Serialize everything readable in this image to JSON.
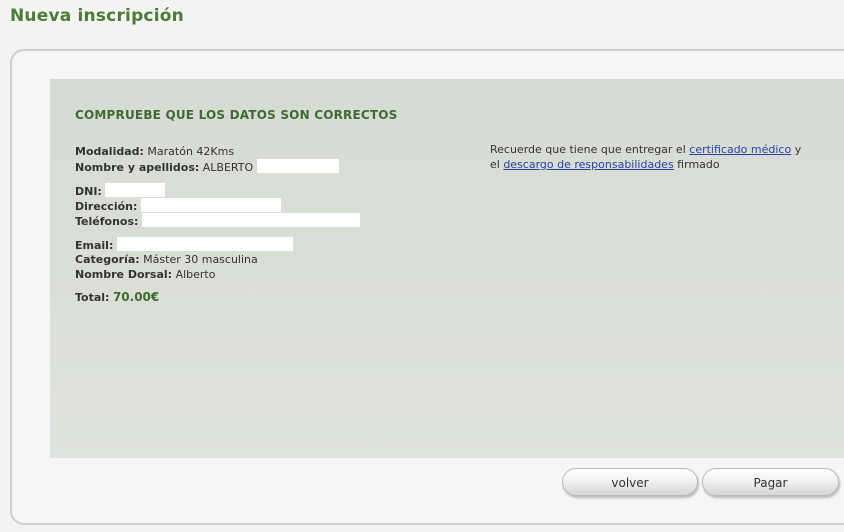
{
  "page": {
    "title": "Nueva inscripción"
  },
  "summary": {
    "heading": "COMPRUEBE QUE LOS DATOS SON CORRECTOS",
    "fields": {
      "modalidad": {
        "label": "Modalidad:",
        "value": "Maratón 42Kms"
      },
      "nombre": {
        "label": "Nombre y apellidos:",
        "value": "ALBERTO"
      },
      "dni": {
        "label": "DNI:"
      },
      "direccion": {
        "label": "Dirección:"
      },
      "telefonos": {
        "label": "Teléfonos:"
      },
      "email": {
        "label": "Email:"
      },
      "categoria": {
        "label": "Categoría:",
        "value": "Máster 30 masculina"
      },
      "dorsal": {
        "label": "Nombre Dorsal:",
        "value": "Alberto"
      }
    },
    "total": {
      "label": "Total:",
      "value": "70.00€"
    }
  },
  "notice": {
    "text_1": "Recuerde que tiene que entregar el ",
    "link_1": "certificado médico",
    "text_2": " y el ",
    "link_2": "descargo de responsabilidades",
    "text_3": " firmado"
  },
  "actions": {
    "back_label": "volver",
    "pay_label": "Pagar"
  }
}
